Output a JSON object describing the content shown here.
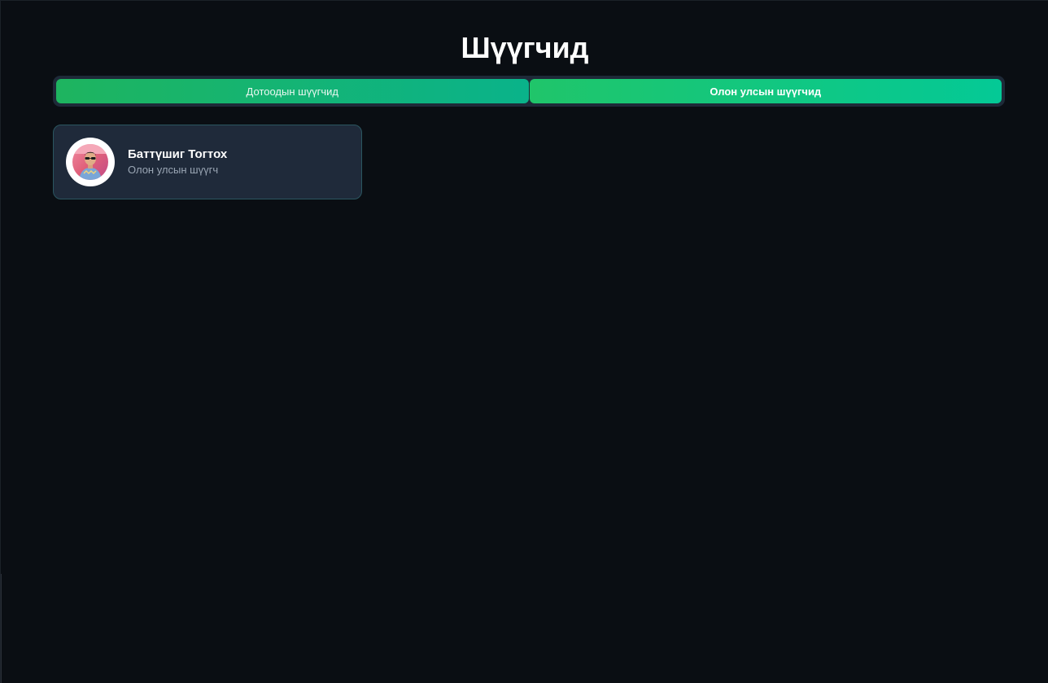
{
  "page": {
    "title": "Шүүгчид"
  },
  "tabs": [
    {
      "label": "Дотоодын шүүгчид",
      "selected": false
    },
    {
      "label": "Олон улсын шүүгчид",
      "selected": true
    }
  ],
  "judges": [
    {
      "name": "Баттүшиг Тогтох",
      "role": "Олон улсын шүүгч",
      "avatar_icon": "person-photo"
    }
  ],
  "colors": {
    "background": "#0a0e13",
    "accent_green": "#20c56a",
    "accent_teal": "#04c996",
    "card_bg": "#1f2a3a",
    "card_border": "#2b5660"
  }
}
